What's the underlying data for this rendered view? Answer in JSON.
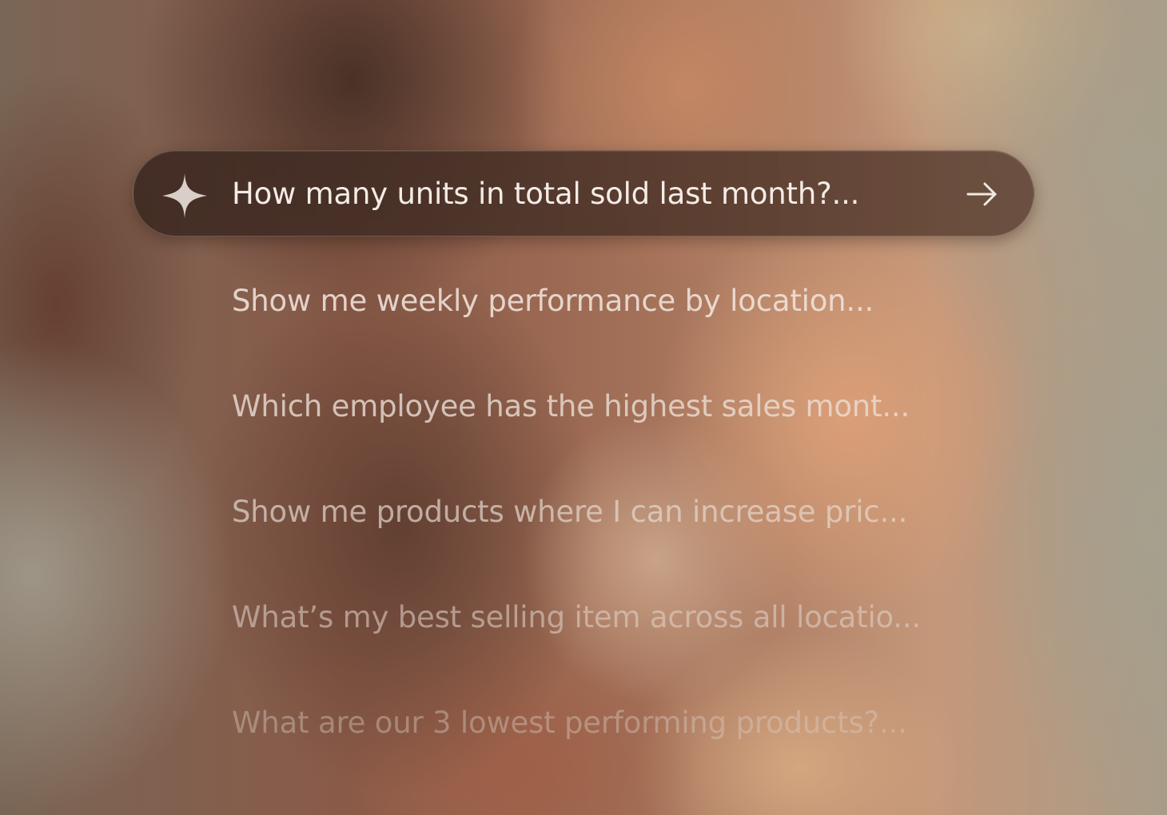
{
  "prompt": {
    "text": "How many units in total sold last month?...",
    "leading_icon": "sparkle-icon",
    "submit_icon": "arrow-right-icon"
  },
  "suggestions": [
    {
      "label": "Show me weekly performance by location..."
    },
    {
      "label": "Which employee has the highest sales mont..."
    },
    {
      "label": "Show me products where I can increase pric..."
    },
    {
      "label": "What’s my best selling item across all locatio..."
    },
    {
      "label": "What are our 3 lowest performing products?..."
    }
  ],
  "colors": {
    "bar_background": "#3e2a22",
    "prompt_text": "#f4ece6",
    "icon": "#d9cfc8"
  }
}
